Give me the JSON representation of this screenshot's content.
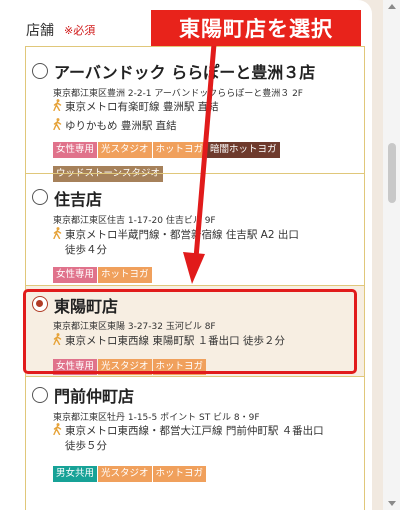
{
  "form": {
    "section_label": "店舗",
    "required_mark": "※必須"
  },
  "annotation": {
    "banner_text": "東陽町店を選択",
    "banner_color": "#e8231b"
  },
  "stores": [
    {
      "name": "アーバンドック ららぽーと豊洲３店",
      "address": "東京都江東区豊洲 2-2-1 アーバンドックららぽーと豊洲３ 2F",
      "access": [
        "東京メトロ有楽町線 豊洲駅 直結",
        "ゆりかもめ 豊洲駅 直結"
      ],
      "tags": [
        "女性専用",
        "光スタジオ",
        "ホットヨガ",
        "暗闇ホットヨガ",
        "ウッドストーンスタジオ"
      ],
      "selected": false
    },
    {
      "name": "住吉店",
      "address": "東京都江東区住吉 1-17-20 住吉ビル 9F",
      "access": [
        "東京メトロ半蔵門線・都営新宿線 住吉駅 A2 出口",
        "徒歩４分"
      ],
      "tags": [
        "女性専用",
        "ホットヨガ"
      ],
      "selected": false
    },
    {
      "name": "東陽町店",
      "address": "東京都江東区東陽 3-27-32 玉河ビル 8F",
      "access": [
        "東京メトロ東西線 東陽町駅 １番出口 徒歩２分"
      ],
      "tags": [
        "女性専用",
        "光スタジオ",
        "ホットヨガ"
      ],
      "selected": true
    },
    {
      "name": "門前仲町店",
      "address": "東京都江東区牡丹 1-15-5 ポイント ST ビル 8・9F",
      "access": [
        "東京メトロ東西線・都営大江戸線 門前仲町駅 ４番出口",
        "徒歩５分"
      ],
      "tags": [
        "男女共用",
        "光スタジオ",
        "ホットヨガ"
      ],
      "selected": false
    }
  ],
  "colors": {
    "tag_women": "#e0728b",
    "tag_orange": "#f0a05c",
    "tag_dark": "#6e3a2c",
    "tag_wood": "#a6815a",
    "tag_mixed": "#17a297",
    "border": "#e0c77a"
  }
}
